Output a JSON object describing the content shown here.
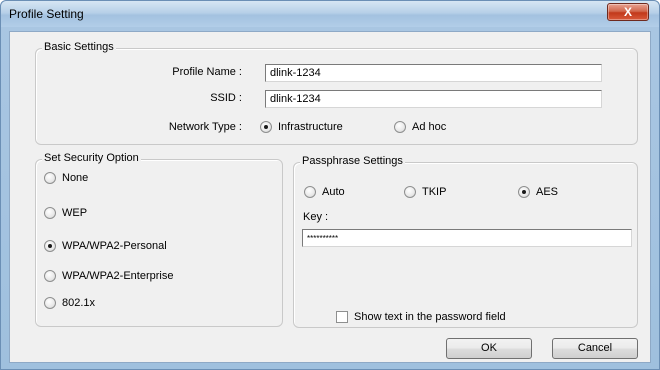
{
  "window": {
    "title": "Profile Setting",
    "close_label": "X"
  },
  "basic_settings": {
    "legend": "Basic Settings",
    "profile_name_label": "Profile Name :",
    "profile_name_value": "dlink-1234",
    "ssid_label": "SSID :",
    "ssid_value": "dlink-1234",
    "network_type_label": "Network Type :",
    "network_types": [
      {
        "label": "Infrastructure",
        "checked": true
      },
      {
        "label": "Ad hoc",
        "checked": false
      }
    ]
  },
  "security": {
    "legend": "Set Security Option",
    "options": [
      {
        "label": "None",
        "checked": false
      },
      {
        "label": "WEP",
        "checked": false
      },
      {
        "label": "WPA/WPA2-Personal",
        "checked": true
      },
      {
        "label": "WPA/WPA2-Enterprise",
        "checked": false
      },
      {
        "label": "802.1x",
        "checked": false
      }
    ]
  },
  "passphrase": {
    "legend": "Passphrase Settings",
    "ciphers": [
      {
        "label": "Auto",
        "checked": false
      },
      {
        "label": "TKIP",
        "checked": false
      },
      {
        "label": "AES",
        "checked": true
      }
    ],
    "key_label": "Key :",
    "key_value": "**********",
    "show_text_label": "Show text in the password field",
    "show_text_checked": false
  },
  "buttons": {
    "ok_label": "OK",
    "cancel_label": "Cancel"
  }
}
